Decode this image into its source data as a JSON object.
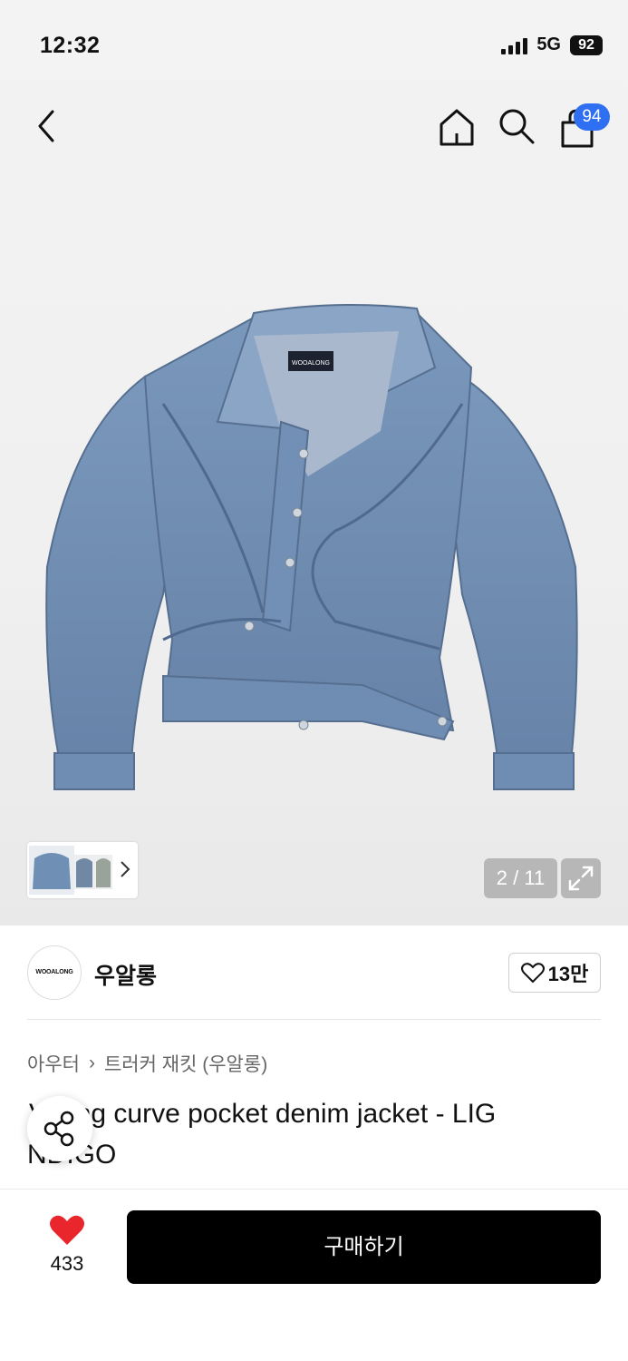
{
  "status_bar": {
    "time": "12:32",
    "network": "5G",
    "battery": "92"
  },
  "nav": {
    "back_icon": "chevron-left-icon",
    "home_icon": "home-icon",
    "search_icon": "search-icon",
    "cart_icon": "shopping-bag-icon",
    "cart_count": "94"
  },
  "gallery": {
    "image_label": "WOOALONG",
    "page_indicator": "2 / 11",
    "accent": "#6f8fb5"
  },
  "brand": {
    "logo_text": "WOOALONG",
    "name": "우알롱",
    "likes": "13만"
  },
  "breadcrumb": {
    "category": "아우터",
    "subcategory": "트러커 재킷 (우알롱)"
  },
  "product": {
    "title_visible": "V  hing curve pocket denim jacket - LIG",
    "title_line2": "  NDIGO"
  },
  "bottom_bar": {
    "wish_count": "433",
    "buy_label": "구매하기",
    "heart_color": "#e8262b"
  }
}
